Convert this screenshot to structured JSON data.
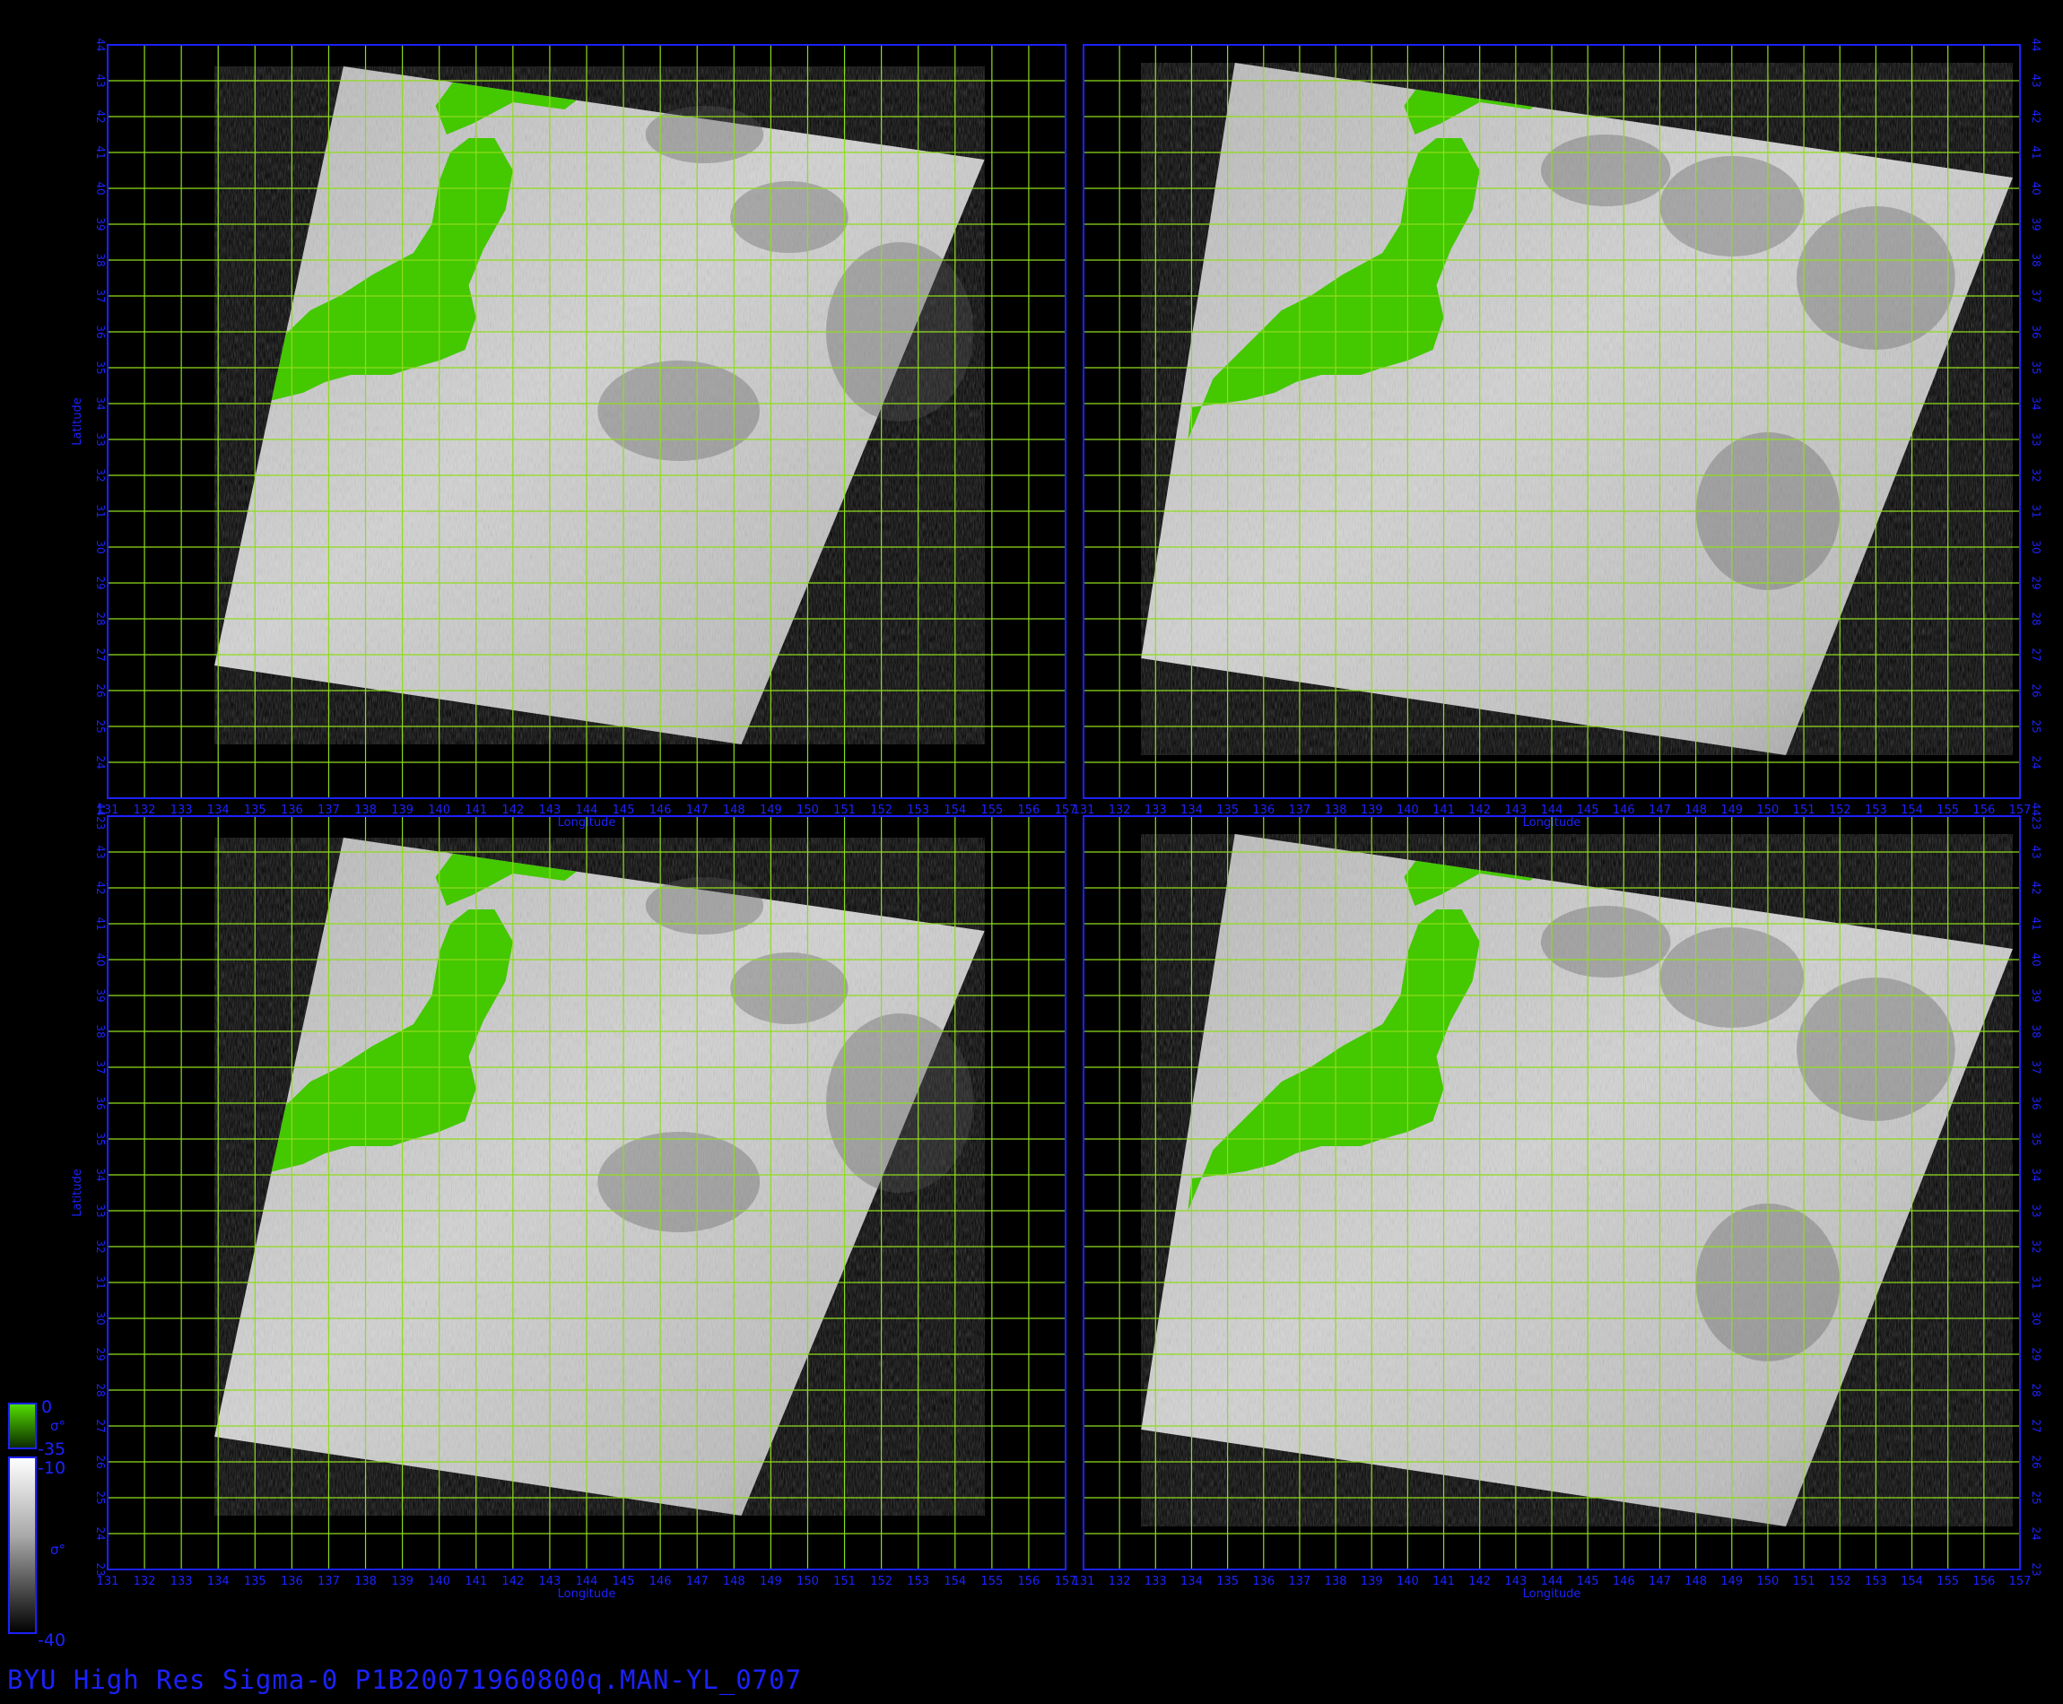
{
  "footer": {
    "caption": "BYU  High  Res  Sigma-0  P1B20071960800q.MAN-YL_0707"
  },
  "axes": {
    "xlabel": "Longitude",
    "ylabel": "Latitude",
    "left_lon_ticks": [
      "131",
      "132",
      "133",
      "134",
      "135",
      "136",
      "137",
      "138",
      "139",
      "140",
      "141",
      "142",
      "143",
      "144",
      "145",
      "146",
      "147",
      "148",
      "149",
      "150",
      "151",
      "152",
      "153",
      "154",
      "155",
      "156",
      "157"
    ],
    "right_lon_ticks": [
      "131",
      "132",
      "133",
      "134",
      "135",
      "136",
      "137",
      "138",
      "139",
      "140",
      "141",
      "142",
      "143",
      "144",
      "145",
      "146",
      "147",
      "148",
      "149",
      "150",
      "151",
      "152",
      "153",
      "154",
      "155",
      "156",
      "157"
    ],
    "lat_ticks_top": [
      "24",
      "25",
      "26",
      "27",
      "28",
      "29",
      "30",
      "31",
      "32",
      "33",
      "34",
      "35",
      "36",
      "37",
      "38",
      "39",
      "40",
      "41",
      "42",
      "43",
      "44"
    ],
    "lat_ticks_bottom": [
      "23",
      "24",
      "25",
      "26",
      "27",
      "28",
      "29",
      "30",
      "31",
      "32",
      "33",
      "34",
      "35",
      "36",
      "37",
      "38",
      "39",
      "40",
      "41",
      "42",
      "43",
      "4423"
    ],
    "lon_range_left": [
      131,
      157
    ],
    "lon_range_right": [
      131,
      157
    ],
    "lat_range": [
      23,
      44
    ]
  },
  "colorbar": {
    "land_top": "0",
    "land_bottom": "-35",
    "land_symbol": "σ°",
    "ocean_top": "-10",
    "ocean_bottom": "-40",
    "ocean_symbol": "σ°"
  },
  "colors": {
    "frame": "#1c22ff",
    "grid": "#8fdc1c",
    "land": "#44c800",
    "background": "#000000"
  },
  "panels": [
    {
      "name": "top-left",
      "lon_range": [
        131,
        157
      ],
      "lat_range": [
        23,
        44
      ]
    },
    {
      "name": "top-right",
      "lon_range": [
        131,
        157
      ],
      "lat_range": [
        23,
        44
      ]
    },
    {
      "name": "bottom-left",
      "lon_range": [
        131,
        157
      ],
      "lat_range": [
        23,
        44
      ]
    },
    {
      "name": "bottom-right",
      "lon_range": [
        131,
        157
      ],
      "lat_range": [
        23,
        44
      ]
    }
  ]
}
